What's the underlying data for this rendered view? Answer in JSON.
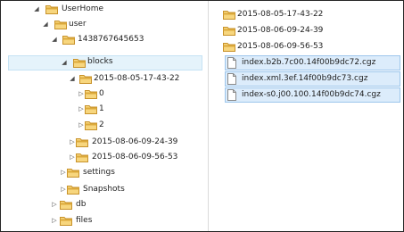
{
  "tree": [
    {
      "label": "UserHome",
      "expanded": true,
      "has_children": true,
      "icon": "folder-icon"
    },
    {
      "label": "user",
      "expanded": true,
      "has_children": true,
      "icon": "folder-icon"
    },
    {
      "label": "1438767645653",
      "expanded": true,
      "has_children": true,
      "icon": "folder-icon"
    },
    {
      "label": "blocks",
      "expanded": true,
      "has_children": true,
      "selected": true,
      "icon": "folder-icon"
    },
    {
      "label": "2015-08-05-17-43-22",
      "expanded": true,
      "has_children": true,
      "icon": "folder-icon"
    },
    {
      "label": "0",
      "expanded": false,
      "has_children": true,
      "icon": "folder-icon"
    },
    {
      "label": "1",
      "expanded": false,
      "has_children": true,
      "icon": "folder-icon"
    },
    {
      "label": "2",
      "expanded": false,
      "has_children": true,
      "icon": "folder-icon"
    },
    {
      "label": "2015-08-06-09-24-39",
      "expanded": false,
      "has_children": true,
      "icon": "folder-icon"
    },
    {
      "label": "2015-08-06-09-56-53",
      "expanded": false,
      "has_children": true,
      "icon": "folder-icon"
    },
    {
      "label": "settings",
      "expanded": false,
      "has_children": true,
      "icon": "folder-icon"
    },
    {
      "label": "Snapshots",
      "expanded": false,
      "has_children": true,
      "icon": "folder-icon"
    },
    {
      "label": "db",
      "expanded": false,
      "has_children": true,
      "icon": "folder-icon"
    },
    {
      "label": "files",
      "expanded": false,
      "has_children": true,
      "icon": "folder-icon"
    }
  ],
  "content": {
    "folders": [
      "2015-08-05-17-43-22",
      "2015-08-06-09-24-39",
      "2015-08-06-09-56-53"
    ],
    "files": [
      "index.b2b.7c00.14f00b9dc72.cgz",
      "index.xml.3ef.14f00b9dc73.cgz",
      "index-s0.j00.100.14f00b9dc74.cgz"
    ]
  },
  "colors": {
    "folder_light": "#f7d67e",
    "folder_dark": "#dcaa3c",
    "folder_edge": "#c8922a",
    "selection_fill": "#e5f3fb",
    "selection_border": "#c5e2f4",
    "file_selection_fill": "#dcecfb",
    "file_selection_border": "#9dc6ec"
  }
}
